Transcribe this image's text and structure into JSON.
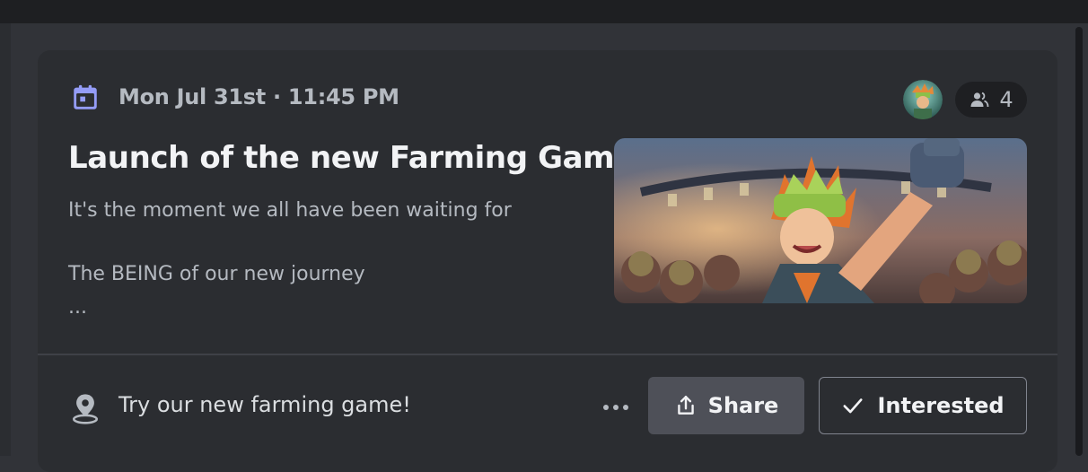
{
  "event": {
    "date_time": "Mon Jul 31st · 11:45 PM",
    "title": "Launch of the new Farming Game",
    "description_lines": [
      "It's the moment we all have been waiting for",
      "The BEING of our new journey",
      "..."
    ],
    "interested_count": "4",
    "location": "Try our new farming game!"
  },
  "actions": {
    "share_label": "Share",
    "interested_label": "Interested"
  },
  "icons": {
    "calendar": "calendar-icon",
    "people": "people-icon",
    "location": "location-pin-icon",
    "more": "more-options-icon",
    "share": "share-icon",
    "check": "checkmark-icon"
  },
  "colors": {
    "background": "#313338",
    "card": "#2b2d31",
    "accent_calendar": "#949cf7",
    "button_secondary": "#4e5058",
    "text_primary": "#f2f3f5",
    "text_muted": "#b5bac1"
  }
}
